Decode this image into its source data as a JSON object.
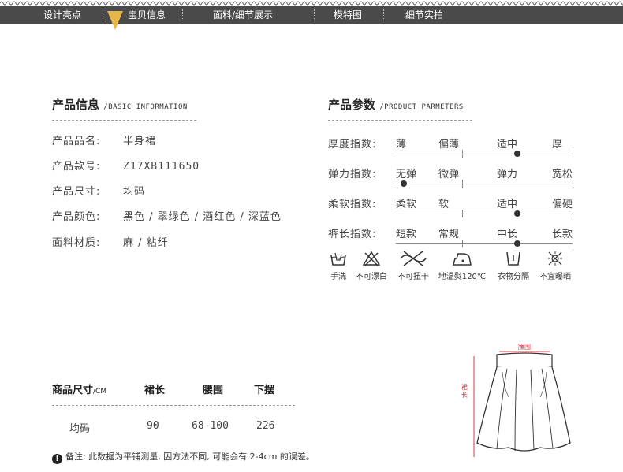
{
  "nav": {
    "items": [
      "设计亮点",
      "宝贝信息",
      "面料/细节展示",
      "模特图",
      "细节实拍"
    ],
    "active_index": 1,
    "bg_color": "#4a4a4a",
    "marker_color": "#e8b54a"
  },
  "product_info": {
    "title_cn": "产品信息",
    "title_en": "/BASIC INFORMATION",
    "rows": [
      {
        "label": "产品品名:",
        "value": "半身裙"
      },
      {
        "label": "产品款号:",
        "value": "Z17XB111650"
      },
      {
        "label": "产品尺寸:",
        "value": "均码"
      },
      {
        "label": "产品颜色:",
        "value": "黑色 / 翠绿色 /  酒红色 / 深蓝色"
      },
      {
        "label": "面料材质:",
        "value": "麻 / 粘纤"
      }
    ]
  },
  "product_params": {
    "title_cn": "产品参数",
    "title_en": "/PRODUCT PARMETERS",
    "rows": [
      {
        "label": "厚度指数:",
        "options": [
          "薄",
          "偏薄",
          "适中",
          "厚"
        ],
        "selected": 2
      },
      {
        "label": "弹力指数:",
        "options": [
          "无弹",
          "微弹",
          "弹力",
          "宽松"
        ],
        "selected": 0
      },
      {
        "label": "柔软指数:",
        "options": [
          "柔软",
          "软",
          "适中",
          "偏硬"
        ],
        "selected": 2
      },
      {
        "label": "裤长指数:",
        "options": [
          "短款",
          "常规",
          "中长",
          "长款"
        ],
        "selected": 2
      }
    ],
    "care": [
      {
        "icon": "hand-wash-icon",
        "label": "手洗"
      },
      {
        "icon": "no-bleach-icon",
        "label": "不可漂白"
      },
      {
        "icon": "no-wring-icon",
        "label": "不可扭干"
      },
      {
        "icon": "low-iron-icon",
        "label": "地温熨120℃"
      },
      {
        "icon": "hang-dry-icon",
        "label": "衣物分隔"
      },
      {
        "icon": "no-sun-dry-icon",
        "label": "不宜曝晒"
      }
    ]
  },
  "size_table": {
    "headers": [
      "商品尺寸",
      "裙长",
      "腰围",
      "下摆"
    ],
    "unit": "/CM",
    "rows": [
      [
        "均码",
        "90",
        "68-100",
        "226"
      ]
    ]
  },
  "diagram": {
    "waist_label": "腰围",
    "length_label": "裙长"
  },
  "note": {
    "icon": "warning-icon",
    "text": "备注: 此数据为平铺测量, 因方法不同, 可能会有 2-4cm 的误差。"
  }
}
